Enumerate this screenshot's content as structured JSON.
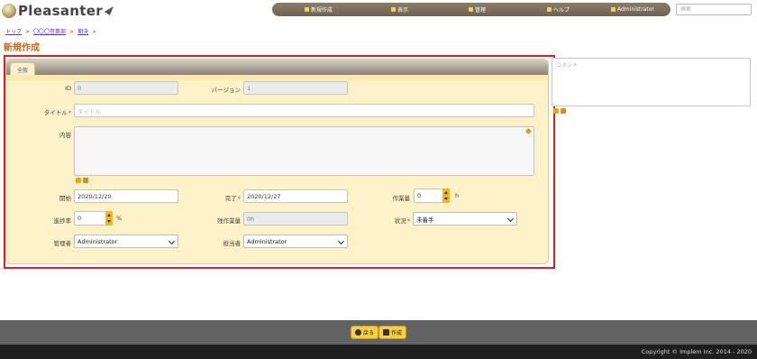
{
  "header": {
    "logo_text": "Pleasanter",
    "nav": [
      {
        "label": "新規作成",
        "icon": "plus-icon"
      },
      {
        "label": "表示",
        "icon": "plus-icon"
      },
      {
        "label": "管理",
        "icon": "gear-icon"
      },
      {
        "label": "ヘルプ",
        "icon": "help-icon"
      },
      {
        "label": "Administrator",
        "icon": "user-icon"
      }
    ],
    "search_placeholder": "検索"
  },
  "breadcrumb": [
    "トップ",
    "〇〇〇営業部",
    "期決"
  ],
  "page_title": "新規作成",
  "tabs": [
    {
      "label": "全般"
    }
  ],
  "form": {
    "id": {
      "label": "ID",
      "value": "0"
    },
    "version": {
      "label": "バージョン",
      "value": "1"
    },
    "title": {
      "label": "タイトル",
      "placeholder": "タイトル"
    },
    "body": {
      "label": "内容",
      "value": ""
    },
    "start": {
      "label": "開始",
      "value": "2020/12/20"
    },
    "end": {
      "label": "完了",
      "value": "2020/12/27"
    },
    "workload": {
      "label": "作業量",
      "value": "0",
      "unit": "h"
    },
    "progress": {
      "label": "進捗率",
      "value": "0",
      "unit": "%"
    },
    "remaining": {
      "label": "残作業量",
      "value": "0h"
    },
    "status": {
      "label": "状況",
      "value": "未着手"
    },
    "manager": {
      "label": "管理者",
      "value": "Administrator"
    },
    "owner": {
      "label": "担当者",
      "value": "Administrator"
    }
  },
  "comment_placeholder": "コメント",
  "footer": {
    "back_label": "戻る",
    "create_label": "作成",
    "copyright": "Copyright © Implem Inc. 2014 - 2020"
  },
  "colors": {
    "title": "#c8691a",
    "highlight": "#e02020",
    "form_bg": "#fdf1c8",
    "button": "#f7cf4a"
  }
}
